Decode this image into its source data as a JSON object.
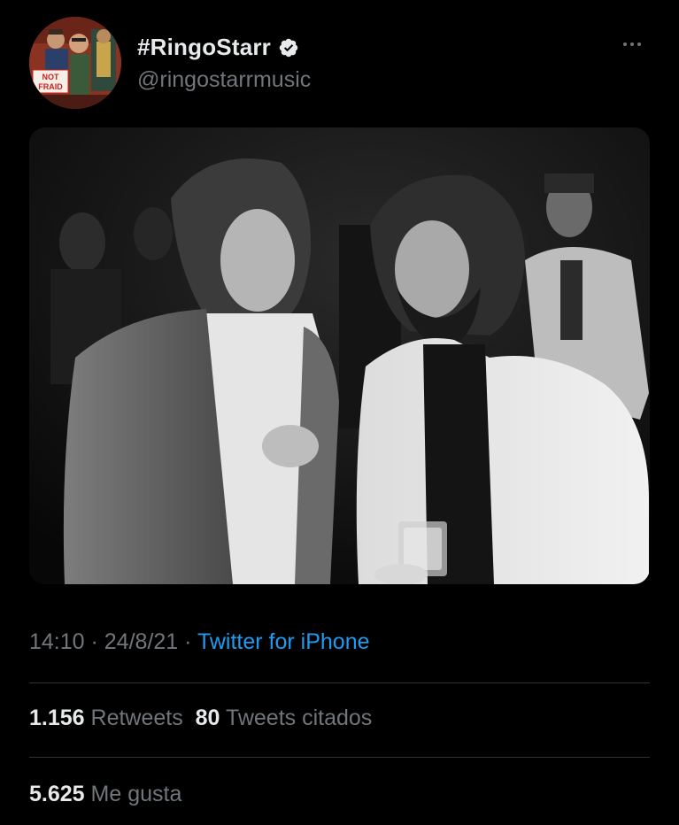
{
  "tweet": {
    "author": {
      "display_name": "#RingoStarr",
      "handle": "@ringostarrmusic",
      "verified": true,
      "avatar_sign_text": "NOT FRAID"
    },
    "more_icon": "more-horizontal-icon",
    "meta": {
      "time": "14:10",
      "separator": " · ",
      "date": "24/8/21",
      "source": "Twitter for iPhone"
    },
    "stats": {
      "retweets_count": "1.156",
      "retweets_label": "Retweets",
      "quotes_count": "80",
      "quotes_label": "Tweets citados",
      "likes_count": "5.625",
      "likes_label": "Me gusta"
    }
  },
  "colors": {
    "background": "#000000",
    "primary_text": "#e7e9ea",
    "secondary_text": "#71767b",
    "link": "#1d9bf0",
    "divider": "#2f3336"
  }
}
